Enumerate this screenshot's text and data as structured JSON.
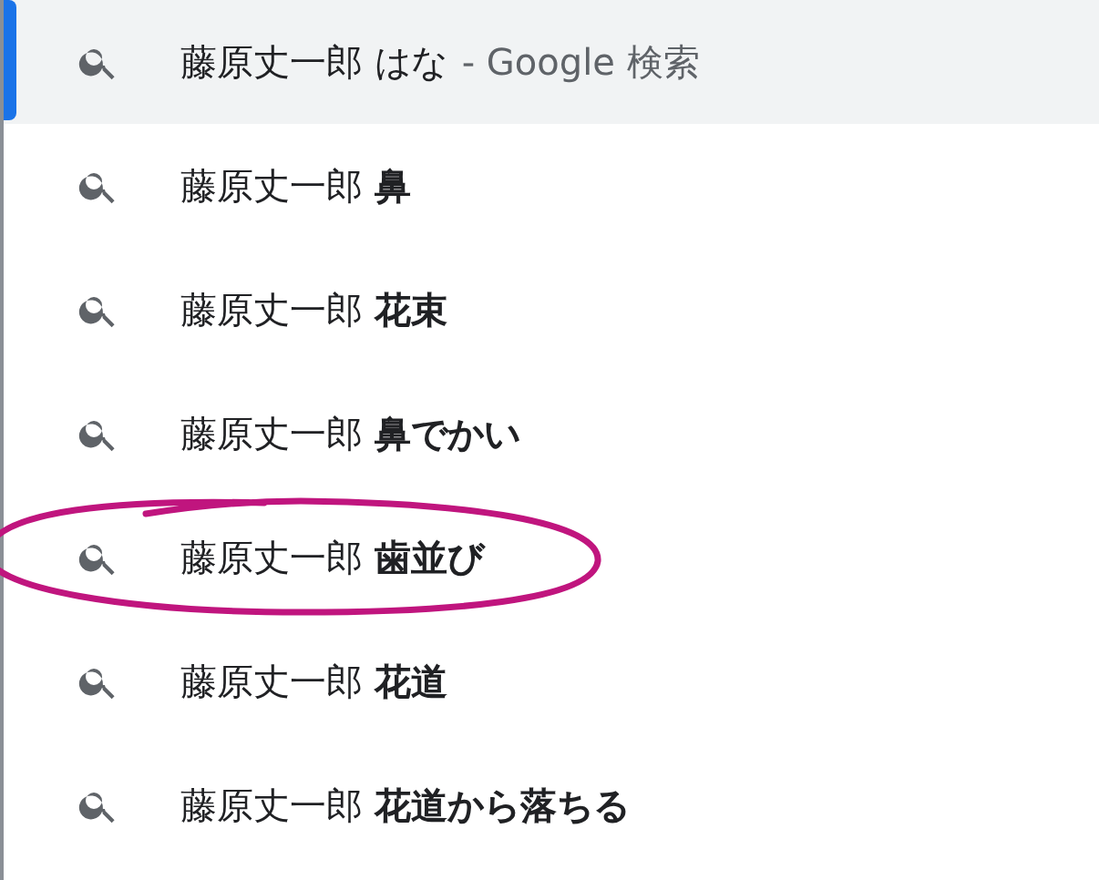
{
  "suggestions": [
    {
      "text": "藤原丈一郎 はな",
      "suffix": "- Google 検索",
      "selected": true,
      "circled": false
    },
    {
      "text": "藤原丈一郎 **鼻**",
      "selected": false,
      "circled": false
    },
    {
      "text": "藤原丈一郎 **花束**",
      "selected": false,
      "circled": false
    },
    {
      "text": "藤原丈一郎 **鼻でかい**",
      "selected": false,
      "circled": false
    },
    {
      "text": "藤原丈一郎 **歯並び**",
      "selected": false,
      "circled": true
    },
    {
      "text": "藤原丈一郎 **花道**",
      "selected": false,
      "circled": false
    },
    {
      "text": "藤原丈一郎 **花道から落ちる**",
      "selected": false,
      "circled": false
    }
  ]
}
